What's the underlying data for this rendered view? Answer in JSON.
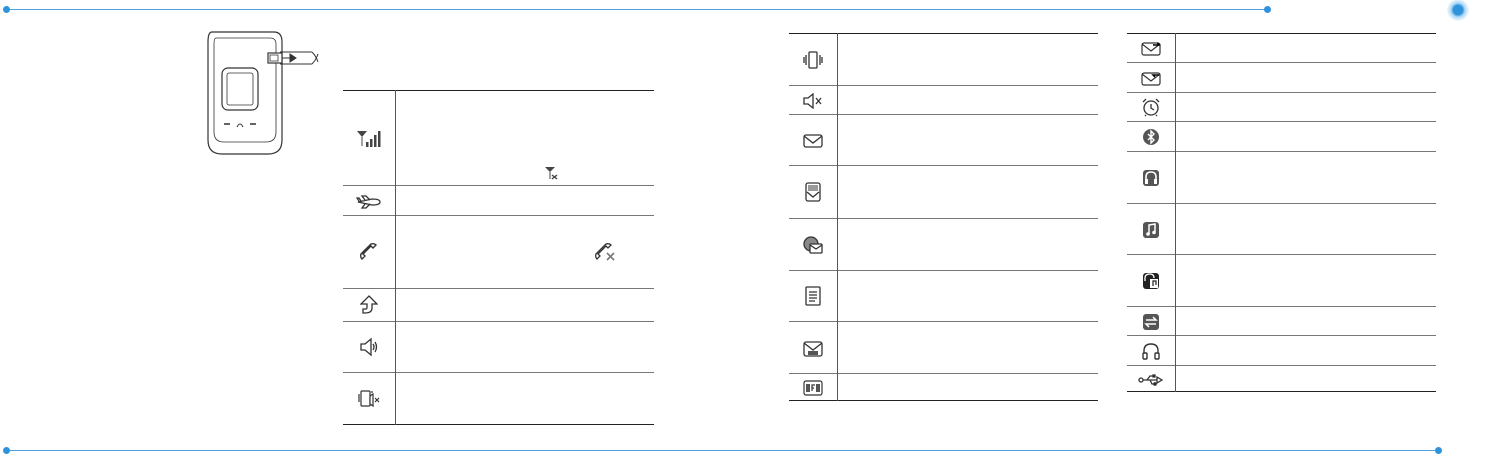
{
  "colors": {
    "accent": "#2f93db",
    "icon": "#444444",
    "rule": "#4aa3e0"
  },
  "illustration": {
    "name": "phone-with-charger-illustration"
  },
  "tables": [
    {
      "icons": [
        "signal-strength-icon",
        "flight-mode-icon",
        "call-active-icon",
        "call-forwarding-icon",
        "speakerphone-icon",
        "silent-vibrate-icon"
      ],
      "inline_icons": [
        "no-signal-icon",
        "no-call-icon"
      ]
    },
    {
      "icons": [
        "vibration-icon",
        "mute-icon",
        "new-message-icon",
        "new-mms-icon",
        "email-icon",
        "new-text-icon",
        "voicemail-icon",
        "facebook-icon"
      ]
    },
    {
      "icons": [
        "message-sending-icon",
        "message-receiving-icon",
        "alarm-icon",
        "bluetooth-icon",
        "bluetooth-headset-icon",
        "music-playing-icon",
        "bluetooth-music-icon",
        "sync-icon",
        "headset-icon",
        "usb-icon"
      ]
    }
  ]
}
